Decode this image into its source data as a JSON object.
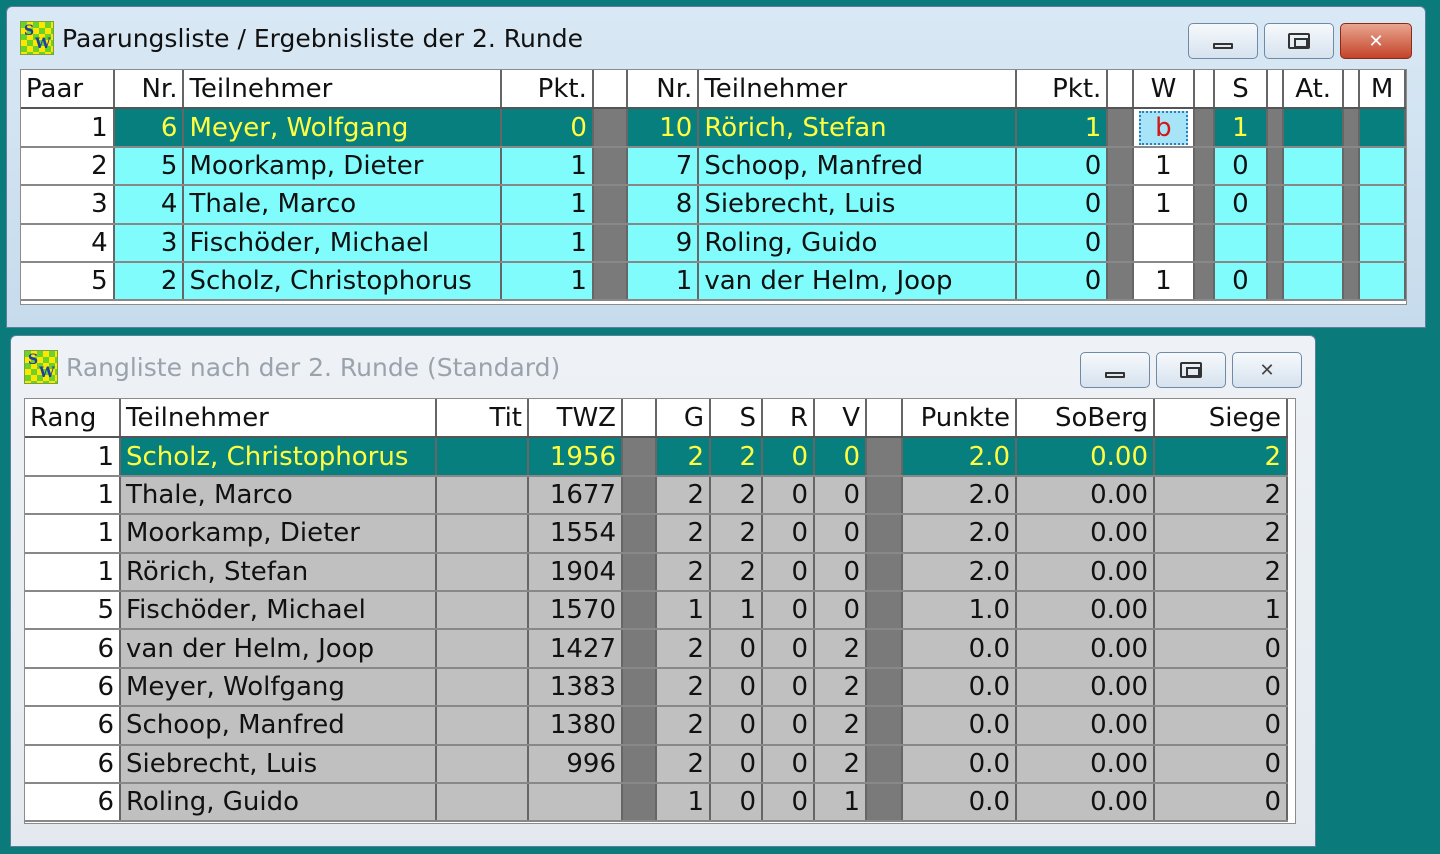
{
  "pairing_window": {
    "title": "Paarungsliste / Ergebnisliste der 2. Runde",
    "icon": "sw-app-icon",
    "icon_letters": [
      "S",
      "W"
    ],
    "columns": [
      "Paar",
      "Nr.",
      "Teilnehmer",
      "Pkt.",
      "",
      "Nr.",
      "Teilnehmer",
      "Pkt.",
      "",
      "W",
      "",
      "S",
      "",
      "At.",
      "",
      "M"
    ],
    "rows": [
      {
        "paar": "1",
        "nr1": "6",
        "name1": "Meyer, Wolfgang",
        "pkt1": "0",
        "nr2": "10",
        "name2": "Rörich, Stefan",
        "pkt2": "1",
        "w": "b",
        "s": "1",
        "at": "",
        "m": ""
      },
      {
        "paar": "2",
        "nr1": "5",
        "name1": "Moorkamp, Dieter",
        "pkt1": "1",
        "nr2": "7",
        "name2": "Schoop, Manfred",
        "pkt2": "0",
        "w": "1",
        "s": "0",
        "at": "",
        "m": ""
      },
      {
        "paar": "3",
        "nr1": "4",
        "name1": "Thale, Marco",
        "pkt1": "1",
        "nr2": "8",
        "name2": "Siebrecht, Luis",
        "pkt2": "0",
        "w": "1",
        "s": "0",
        "at": "",
        "m": ""
      },
      {
        "paar": "4",
        "nr1": "3",
        "name1": "Fischöder, Michael",
        "pkt1": "1",
        "nr2": "9",
        "name2": "Roling, Guido",
        "pkt2": "0",
        "w": "",
        "s": "",
        "at": "",
        "m": ""
      },
      {
        "paar": "5",
        "nr1": "2",
        "name1": "Scholz, Christophorus",
        "pkt1": "1",
        "nr2": "1",
        "name2": "van der Helm, Joop",
        "pkt2": "0",
        "w": "1",
        "s": "0",
        "at": "",
        "m": ""
      }
    ],
    "selected_row": 0
  },
  "ranking_window": {
    "title": "Rangliste nach der 2. Runde (Standard)",
    "icon": "sw-app-icon",
    "icon_letters": [
      "S",
      "W"
    ],
    "columns": [
      "Rang",
      "Teilnehmer",
      "Tit",
      "TWZ",
      "",
      "G",
      "S",
      "R",
      "V",
      "",
      "Punkte",
      "SoBerg",
      "Siege"
    ],
    "rows": [
      {
        "rang": "1",
        "name": "Scholz, Christophorus",
        "tit": "",
        "twz": "1956",
        "g": "2",
        "s": "2",
        "r": "0",
        "v": "0",
        "punkte": "2.0",
        "soberg": "0.00",
        "siege": "2"
      },
      {
        "rang": "1",
        "name": "Thale, Marco",
        "tit": "",
        "twz": "1677",
        "g": "2",
        "s": "2",
        "r": "0",
        "v": "0",
        "punkte": "2.0",
        "soberg": "0.00",
        "siege": "2"
      },
      {
        "rang": "1",
        "name": "Moorkamp, Dieter",
        "tit": "",
        "twz": "1554",
        "g": "2",
        "s": "2",
        "r": "0",
        "v": "0",
        "punkte": "2.0",
        "soberg": "0.00",
        "siege": "2"
      },
      {
        "rang": "1",
        "name": "Rörich, Stefan",
        "tit": "",
        "twz": "1904",
        "g": "2",
        "s": "2",
        "r": "0",
        "v": "0",
        "punkte": "2.0",
        "soberg": "0.00",
        "siege": "2"
      },
      {
        "rang": "5",
        "name": "Fischöder, Michael",
        "tit": "",
        "twz": "1570",
        "g": "1",
        "s": "1",
        "r": "0",
        "v": "0",
        "punkte": "1.0",
        "soberg": "0.00",
        "siege": "1"
      },
      {
        "rang": "6",
        "name": "van der Helm, Joop",
        "tit": "",
        "twz": "1427",
        "g": "2",
        "s": "0",
        "r": "0",
        "v": "2",
        "punkte": "0.0",
        "soberg": "0.00",
        "siege": "0"
      },
      {
        "rang": "6",
        "name": "Meyer, Wolfgang",
        "tit": "",
        "twz": "1383",
        "g": "2",
        "s": "0",
        "r": "0",
        "v": "2",
        "punkte": "0.0",
        "soberg": "0.00",
        "siege": "0"
      },
      {
        "rang": "6",
        "name": "Schoop, Manfred",
        "tit": "",
        "twz": "1380",
        "g": "2",
        "s": "0",
        "r": "0",
        "v": "2",
        "punkte": "0.0",
        "soberg": "0.00",
        "siege": "0"
      },
      {
        "rang": "6",
        "name": "Siebrecht, Luis",
        "tit": "",
        "twz": "996",
        "g": "2",
        "s": "0",
        "r": "0",
        "v": "2",
        "punkte": "0.0",
        "soberg": "0.00",
        "siege": "0"
      },
      {
        "rang": "6",
        "name": "Roling, Guido",
        "tit": "",
        "twz": "",
        "g": "1",
        "s": "0",
        "r": "0",
        "v": "1",
        "punkte": "0.0",
        "soberg": "0.00",
        "siege": "0"
      }
    ],
    "selected_row": 0
  },
  "colors": {
    "desktop": "#0a7a7a",
    "row_cyan": "#80fcfc",
    "row_gray": "#c0c0c0",
    "selected_bg": "#087f7f",
    "selected_text": "#ffff40"
  }
}
